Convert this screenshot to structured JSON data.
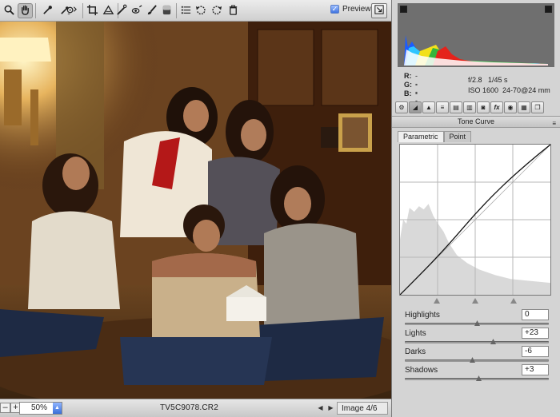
{
  "toolbar": {
    "tools": [
      {
        "name": "zoom-tool",
        "icon": "magnifier-icon",
        "active": false
      },
      {
        "name": "hand-tool",
        "icon": "hand-icon",
        "active": true
      },
      {
        "name": "white-balance-tool",
        "icon": "eyedropper-icon",
        "active": false
      },
      {
        "name": "color-sampler-tool",
        "icon": "color-sampler-icon",
        "active": false
      },
      {
        "name": "targeted-adjustment-tool",
        "icon": "target-adjust-icon",
        "active": false
      },
      {
        "name": "crop-tool",
        "icon": "crop-icon",
        "active": false
      },
      {
        "name": "straighten-tool",
        "icon": "straighten-icon",
        "active": false
      },
      {
        "name": "spot-removal-tool",
        "icon": "spot-removal-icon",
        "active": false
      },
      {
        "name": "red-eye-tool",
        "icon": "red-eye-icon",
        "active": false
      },
      {
        "name": "adjustment-brush-tool",
        "icon": "brush-icon",
        "active": false
      },
      {
        "name": "graduated-filter-tool",
        "icon": "graduated-filter-icon",
        "active": false
      },
      {
        "name": "preferences-button",
        "icon": "list-icon",
        "active": false
      },
      {
        "name": "rotate-left-button",
        "icon": "rotate-ccw-icon",
        "active": false
      },
      {
        "name": "rotate-right-button",
        "icon": "rotate-cw-icon",
        "active": false
      },
      {
        "name": "delete-button",
        "icon": "trash-icon",
        "active": false
      }
    ],
    "preview_label": "Preview",
    "preview_checked": true,
    "fullscreen_icon": "fullscreen-icon"
  },
  "status": {
    "zoom_value": "50%",
    "filename": "TV5C9078.CR2",
    "image_count": "Image 4/6"
  },
  "info": {
    "r_label": "R:",
    "r_value": "---",
    "g_label": "G:",
    "g_value": "---",
    "b_label": "B:",
    "b_value": "---",
    "aperture": "f/2.8",
    "shutter": "1/45 s",
    "iso": "ISO 1600",
    "lens": "24-70@24 mm"
  },
  "panel": {
    "tabs": [
      "basic",
      "tone-curve",
      "detail",
      "hsl",
      "split-toning",
      "lens-corrections",
      "camera-calibration",
      "fx",
      "presets",
      "snapshots",
      "extra"
    ],
    "section_title": "Tone Curve",
    "subtabs": [
      "Parametric",
      "Point"
    ],
    "active_subtab": "Parametric"
  },
  "sliders": [
    {
      "label": "Highlights",
      "value": "0",
      "position": 0.5
    },
    {
      "label": "Lights",
      "value": "+23",
      "position": 0.615
    },
    {
      "label": "Darks",
      "value": "-6",
      "position": 0.47
    },
    {
      "label": "Shadows",
      "value": "+3",
      "position": 0.515
    }
  ],
  "colors": {
    "histogram_bg": "#6f6f6f",
    "accent": "#3f73e0"
  }
}
